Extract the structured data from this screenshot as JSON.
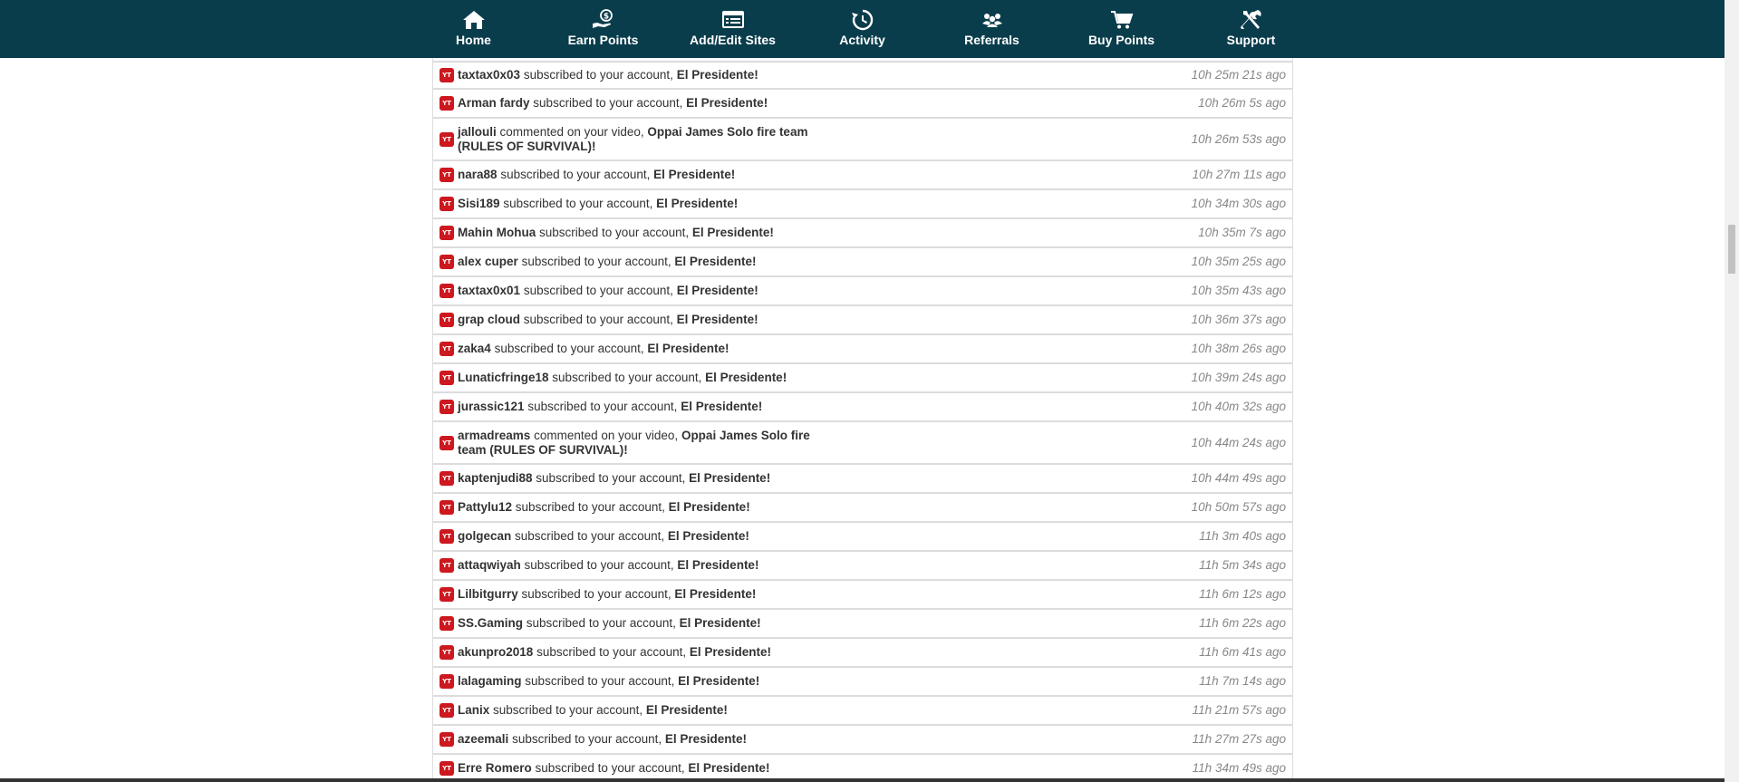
{
  "nav": {
    "items": [
      {
        "label": "Home",
        "icon": "home-icon"
      },
      {
        "label": "Earn Points",
        "icon": "earn-points-icon"
      },
      {
        "label": "Add/Edit Sites",
        "icon": "sites-list-icon"
      },
      {
        "label": "Activity",
        "icon": "history-icon"
      },
      {
        "label": "Referrals",
        "icon": "referrals-icon"
      },
      {
        "label": "Buy Points",
        "icon": "cart-icon"
      },
      {
        "label": "Support",
        "icon": "tools-icon"
      }
    ]
  },
  "colors": {
    "topbar": "#0a3d4c",
    "badge": "#cc181e"
  },
  "badge_text": "YT",
  "feed": [
    {
      "user": "taxtax0x03",
      "action": "subscribed to your account,",
      "target": "El Presidente!",
      "time": "10h 25m 21s ago"
    },
    {
      "user": "Arman fardy",
      "action": "subscribed to your account,",
      "target": "El Presidente!",
      "time": "10h 26m 5s ago"
    },
    {
      "user": "jallouli",
      "action": "commented on your video,",
      "target": "Oppai James Solo fire team (RULES OF SURVIVAL)!",
      "time": "10h 26m 53s ago"
    },
    {
      "user": "nara88",
      "action": "subscribed to your account,",
      "target": "El Presidente!",
      "time": "10h 27m 11s ago"
    },
    {
      "user": "Sisi189",
      "action": "subscribed to your account,",
      "target": "El Presidente!",
      "time": "10h 34m 30s ago"
    },
    {
      "user": "Mahin Mohua",
      "action": "subscribed to your account,",
      "target": "El Presidente!",
      "time": "10h 35m 7s ago"
    },
    {
      "user": "alex cuper",
      "action": "subscribed to your account,",
      "target": "El Presidente!",
      "time": "10h 35m 25s ago"
    },
    {
      "user": "taxtax0x01",
      "action": "subscribed to your account,",
      "target": "El Presidente!",
      "time": "10h 35m 43s ago"
    },
    {
      "user": "grap cloud",
      "action": "subscribed to your account,",
      "target": "El Presidente!",
      "time": "10h 36m 37s ago"
    },
    {
      "user": "zaka4",
      "action": "subscribed to your account,",
      "target": "El Presidente!",
      "time": "10h 38m 26s ago"
    },
    {
      "user": "Lunaticfringe18",
      "action": "subscribed to your account,",
      "target": "El Presidente!",
      "time": "10h 39m 24s ago"
    },
    {
      "user": "jurassic121",
      "action": "subscribed to your account,",
      "target": "El Presidente!",
      "time": "10h 40m 32s ago"
    },
    {
      "user": "armadreams",
      "action": "commented on your video,",
      "target": "Oppai James Solo fire team (RULES OF SURVIVAL)!",
      "time": "10h 44m 24s ago"
    },
    {
      "user": "kaptenjudi88",
      "action": "subscribed to your account,",
      "target": "El Presidente!",
      "time": "10h 44m 49s ago"
    },
    {
      "user": "Pattylu12",
      "action": "subscribed to your account,",
      "target": "El Presidente!",
      "time": "10h 50m 57s ago"
    },
    {
      "user": "golgecan",
      "action": "subscribed to your account,",
      "target": "El Presidente!",
      "time": "11h 3m 40s ago"
    },
    {
      "user": "attaqwiyah",
      "action": "subscribed to your account,",
      "target": "El Presidente!",
      "time": "11h 5m 34s ago"
    },
    {
      "user": "Lilbitgurry",
      "action": "subscribed to your account,",
      "target": "El Presidente!",
      "time": "11h 6m 12s ago"
    },
    {
      "user": "SS.Gaming",
      "action": "subscribed to your account,",
      "target": "El Presidente!",
      "time": "11h 6m 22s ago"
    },
    {
      "user": "akunpro2018",
      "action": "subscribed to your account,",
      "target": "El Presidente!",
      "time": "11h 6m 41s ago"
    },
    {
      "user": "lalagaming",
      "action": "subscribed to your account,",
      "target": "El Presidente!",
      "time": "11h 7m 14s ago"
    },
    {
      "user": "Lanix",
      "action": "subscribed to your account,",
      "target": "El Presidente!",
      "time": "11h 21m 57s ago"
    },
    {
      "user": "azeemali",
      "action": "subscribed to your account,",
      "target": "El Presidente!",
      "time": "11h 27m 27s ago"
    },
    {
      "user": "Erre Romero",
      "action": "subscribed to your account,",
      "target": "El Presidente!",
      "time": "11h 34m 49s ago"
    }
  ]
}
